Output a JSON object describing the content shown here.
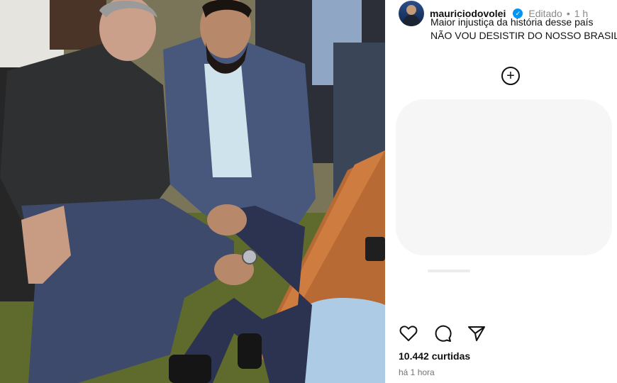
{
  "post": {
    "username": "mauriciodovolei",
    "verified_glyph": "✓",
    "edited_label": "Editado",
    "separator": "•",
    "time_short": "1 h",
    "caption_line1": "Maior injustiça da história desse país",
    "caption_line2": "NÃO VOU DESISTIR DO NOSSO BRASIL",
    "more_glyph": "+",
    "likes_text": "10.442 curtidas",
    "time_long": "há 1 hora",
    "photo_description_icon": "photo-placeholder"
  },
  "icons": {
    "like": "heart-icon",
    "comment": "comment-icon",
    "share": "share-icon",
    "more": "plus-circle-icon"
  },
  "colors": {
    "verified": "#0095f6",
    "text": "#111111",
    "muted": "#737373"
  }
}
